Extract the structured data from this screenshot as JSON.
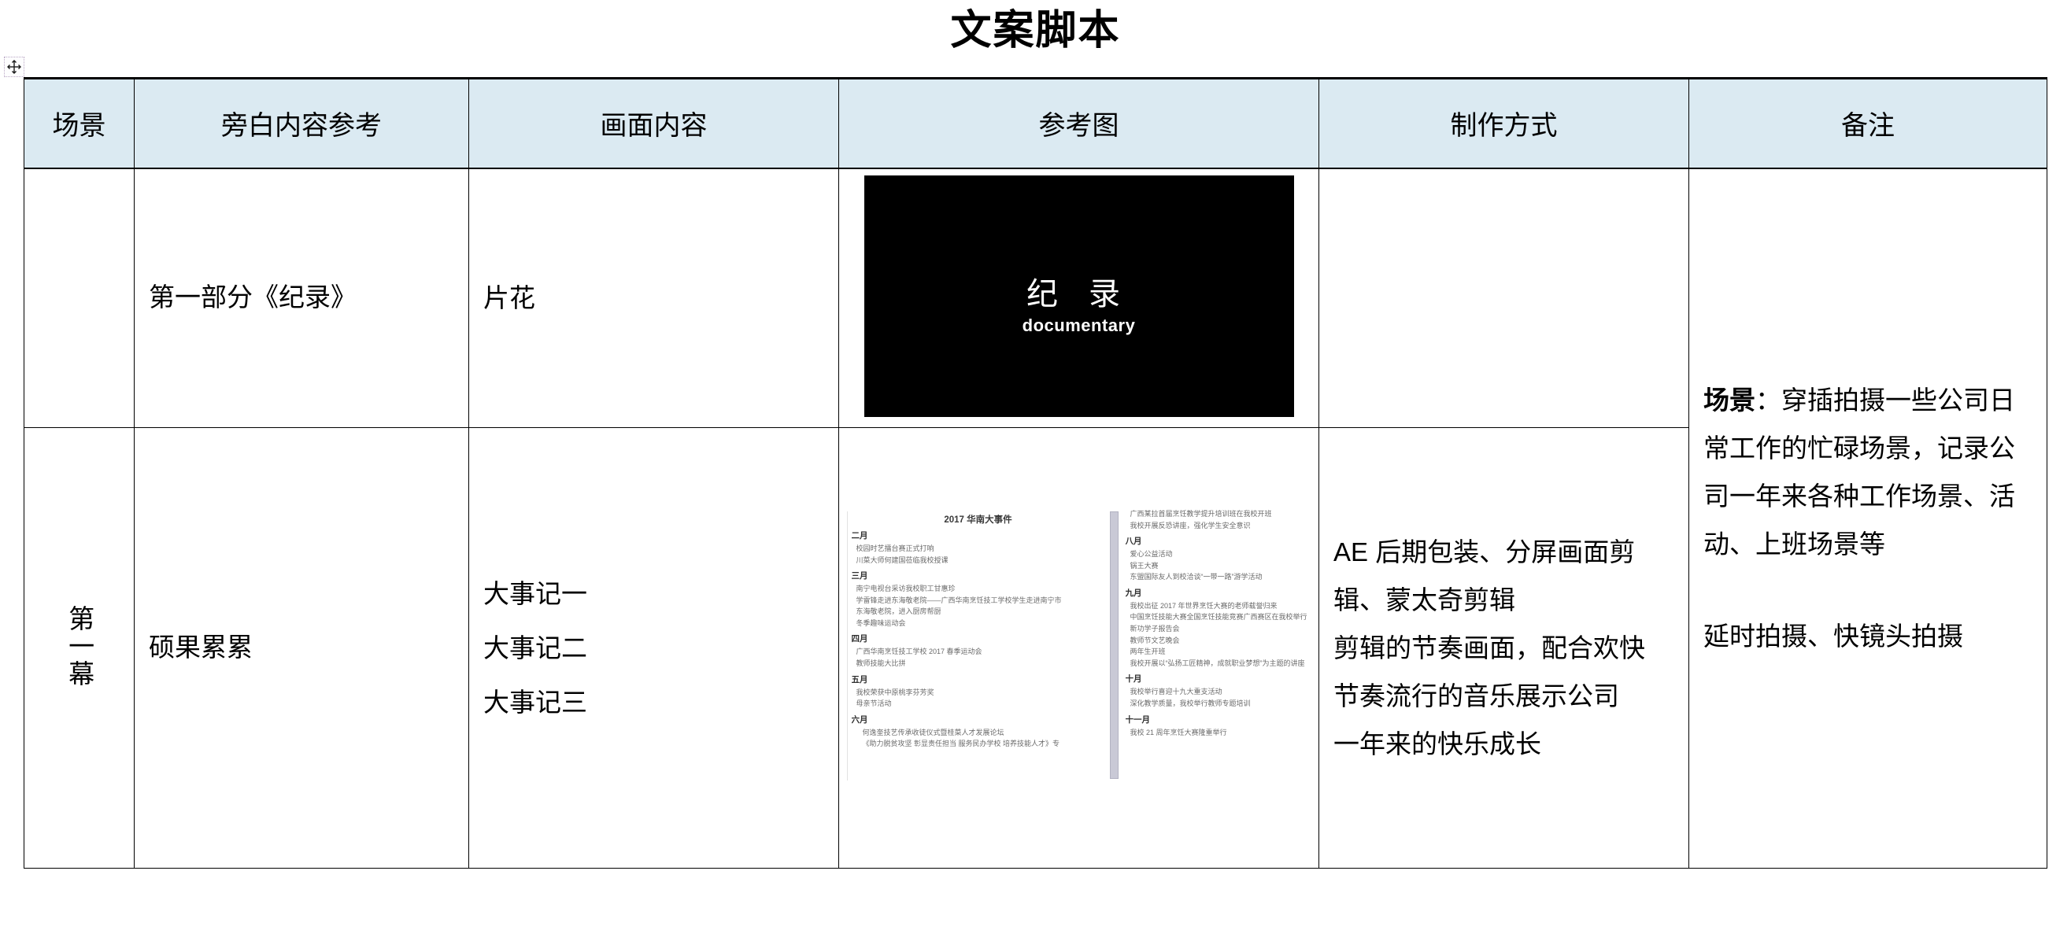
{
  "document": {
    "title": "文案脚本"
  },
  "table": {
    "headers": [
      "场景",
      "旁白内容参考",
      "画面内容",
      "参考图",
      "制作方式",
      "备注"
    ],
    "rows": [
      {
        "scene": "",
        "narration": "第一部分《纪录》",
        "shots": [
          "片花"
        ],
        "reference": {
          "type": "black-title-card",
          "cn_title": "纪 录",
          "en_subtitle": "documentary"
        },
        "production": "",
        "note": ""
      },
      {
        "scene": "第一幕",
        "narration": "硕果累累",
        "shots": [
          "大事记一",
          "大事记二",
          "大事记三"
        ],
        "reference": {
          "type": "events-document",
          "doc_title": "2017 华南大事件",
          "left_column": [
            {
              "month": "二月",
              "items": [
                "校园时艺擂台赛正式打响",
                "川菜大师何建国莅临我校授课"
              ]
            },
            {
              "month": "三月",
              "items": [
                "南宁电视台采访我校职工甘惠珍",
                "学雷锋走进东海敬老院——广西华南烹饪技工学校学生走进南宁市",
                "东海敬老院，进入厨房帮厨",
                "冬季趣味运动会"
              ]
            },
            {
              "month": "四月",
              "items": [
                "广西华南烹饪技工学校 2017 春季运动会",
                "教师技能大比拼"
              ]
            },
            {
              "month": "五月",
              "items": [
                "我校荣获中原桃李芬芳奖",
                "母亲节活动"
              ]
            },
            {
              "month": "六月",
              "items": [
                "何逸奎技艺传承收徒仪式暨桂菜人才发展论坛",
                "《助力脱贫攻坚 彰显责任担当 服务民办学校 培养技能人才》专"
              ]
            }
          ],
          "right_column": [
            {
              "month": "",
              "items": [
                "广西某拉首届烹饪教学提升培训班在我校开班",
                "我校开展反恐讲座，强化学生安全意识"
              ]
            },
            {
              "month": "八月",
              "items": [
                "爱心公益活动",
                "锅王大赛",
                "东盟国际友人到校洽谈“一带一路”游学活动"
              ]
            },
            {
              "month": "九月",
              "items": [
                "我校出征 2017 年世界烹饪大赛的老师载誉归来",
                "中国烹饪技能大赛全国烹饪技能竞赛广西赛区在我校举行",
                "新功学子报告会",
                "教师节文艺晚会",
                "两年生开班",
                "我校开展以“弘扬工匠精神，成就职业梦想”为主题的讲座"
              ]
            },
            {
              "month": "十月",
              "items": [
                "我校举行喜迎十九大重支活动",
                "深化教学质量，我校举行教师专题培训"
              ]
            },
            {
              "month": "十一月",
              "items": [
                "我校 21 周年烹饪大赛隆重举行"
              ]
            }
          ]
        },
        "production": "AE 后期包装、分屏画面剪辑、蒙太奇剪辑\n剪辑的节奏画面，配合欢快节奏流行的音乐展示公司一年来的快乐成长",
        "production_lines": [
          "AE 后期包装、分屏画面剪",
          "辑、蒙太奇剪辑",
          "剪辑的节奏画面，配合欢快",
          "节奏流行的音乐展示公司",
          "一年来的快乐成长"
        ],
        "note": ""
      }
    ],
    "note_merged": {
      "label": "场景",
      "separator": "：",
      "body_lines": [
        "穿插拍摄一些公司日",
        "常工作的忙碌场景，记录公",
        "司一年来各种工作场景、活",
        "动、上班场景等"
      ],
      "second_block": "延时拍摄、快镜头拍摄"
    }
  },
  "icons": {
    "table_move_handle": "move-handle-icon"
  },
  "colors": {
    "header_background": "#dbeaf2",
    "border": "#000000",
    "text": "#000000",
    "still_background": "#000000",
    "still_text": "#ffffff"
  }
}
